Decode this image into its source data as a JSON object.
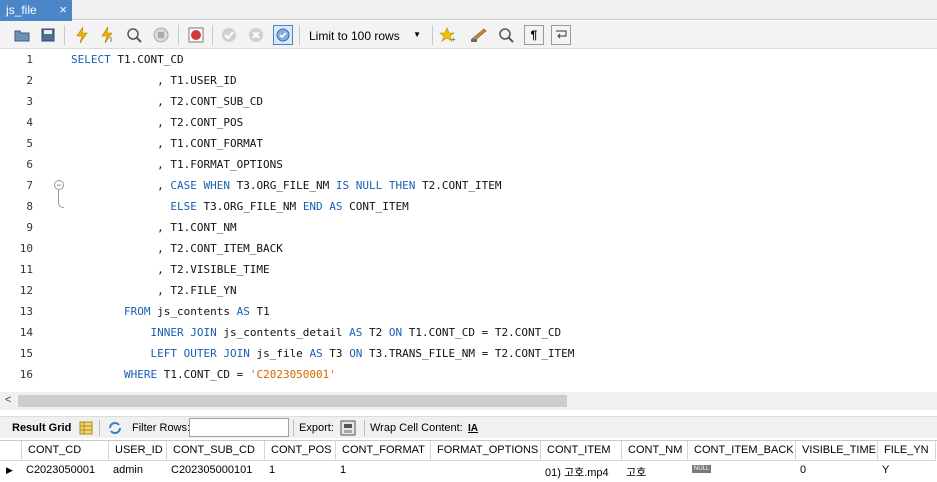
{
  "tab": {
    "label": "js_file",
    "close": "×"
  },
  "toolbar": {
    "limit_label": "Limit to 100 rows"
  },
  "editor": {
    "lines": [
      {
        "num": "1",
        "segments": [
          [
            "kw",
            "SELECT"
          ],
          [
            "t",
            " T1.CONT_CD"
          ]
        ]
      },
      {
        "num": "2",
        "segments": [
          [
            "t",
            "             , T1.USER_ID"
          ]
        ]
      },
      {
        "num": "3",
        "segments": [
          [
            "t",
            "             , T2.CONT_SUB_CD"
          ]
        ]
      },
      {
        "num": "4",
        "segments": [
          [
            "t",
            "             , T2.CONT_POS"
          ]
        ]
      },
      {
        "num": "5",
        "segments": [
          [
            "t",
            "             , T1.CONT_FORMAT"
          ]
        ]
      },
      {
        "num": "6",
        "segments": [
          [
            "t",
            "             , T1.FORMAT_OPTIONS"
          ]
        ]
      },
      {
        "num": "7",
        "segments": [
          [
            "t",
            "             , "
          ],
          [
            "kw",
            "CASE WHEN"
          ],
          [
            "t",
            " T3.ORG_FILE_NM "
          ],
          [
            "kw",
            "IS NULL THEN"
          ],
          [
            "t",
            " T2.CONT_ITEM"
          ]
        ]
      },
      {
        "num": "8",
        "segments": [
          [
            "t",
            "               "
          ],
          [
            "kw",
            "ELSE"
          ],
          [
            "t",
            " T3.ORG_FILE_NM "
          ],
          [
            "kw",
            "END AS"
          ],
          [
            "t",
            " CONT_ITEM"
          ]
        ]
      },
      {
        "num": "9",
        "segments": [
          [
            "t",
            "             , T1.CONT_NM"
          ]
        ]
      },
      {
        "num": "10",
        "segments": [
          [
            "t",
            "             , T2.CONT_ITEM_BACK"
          ]
        ]
      },
      {
        "num": "11",
        "segments": [
          [
            "t",
            "             , T2.VISIBLE_TIME"
          ]
        ]
      },
      {
        "num": "12",
        "segments": [
          [
            "t",
            "             , T2.FILE_YN"
          ]
        ]
      },
      {
        "num": "13",
        "segments": [
          [
            "t",
            "        "
          ],
          [
            "kw",
            "FROM"
          ],
          [
            "t",
            " js_contents "
          ],
          [
            "kw",
            "AS"
          ],
          [
            "t",
            " T1"
          ]
        ]
      },
      {
        "num": "14",
        "segments": [
          [
            "t",
            "            "
          ],
          [
            "kw",
            "INNER JOIN"
          ],
          [
            "t",
            " js_contents_detail "
          ],
          [
            "kw",
            "AS"
          ],
          [
            "t",
            " T2 "
          ],
          [
            "kw",
            "ON"
          ],
          [
            "t",
            " T1.CONT_CD = T2.CONT_CD"
          ]
        ]
      },
      {
        "num": "15",
        "segments": [
          [
            "t",
            "            "
          ],
          [
            "kw",
            "LEFT OUTER JOIN"
          ],
          [
            "t",
            " js_file "
          ],
          [
            "kw",
            "AS"
          ],
          [
            "t",
            " T3 "
          ],
          [
            "kw",
            "ON"
          ],
          [
            "t",
            " T3.TRANS_FILE_NM = T2.CONT_ITEM"
          ]
        ]
      },
      {
        "num": "16",
        "segments": [
          [
            "t",
            "        "
          ],
          [
            "kw",
            "WHERE"
          ],
          [
            "t",
            " T1.CONT_CD = "
          ],
          [
            "str",
            "'C2023050001'"
          ]
        ]
      }
    ]
  },
  "results": {
    "result_grid_label": "Result Grid",
    "filter_rows_label": "Filter Rows:",
    "export_label": "Export:",
    "wrap_label": "Wrap Cell Content:",
    "columns": [
      "CONT_CD",
      "USER_ID",
      "CONT_SUB_CD",
      "CONT_POS",
      "CONT_FORMAT",
      "FORMAT_OPTIONS",
      "CONT_ITEM",
      "CONT_NM",
      "CONT_ITEM_BACK",
      "VISIBLE_TIME",
      "FILE_YN"
    ],
    "rows": [
      [
        "C2023050001",
        "admin",
        "C202305000101",
        "1",
        "1",
        "",
        "01) 고호.mp4",
        "고호",
        "NULL",
        "0",
        "Y"
      ]
    ]
  },
  "colors": {
    "keyword": "#1a5fb4",
    "string": "#d66400",
    "tab": "#4a86c8"
  }
}
